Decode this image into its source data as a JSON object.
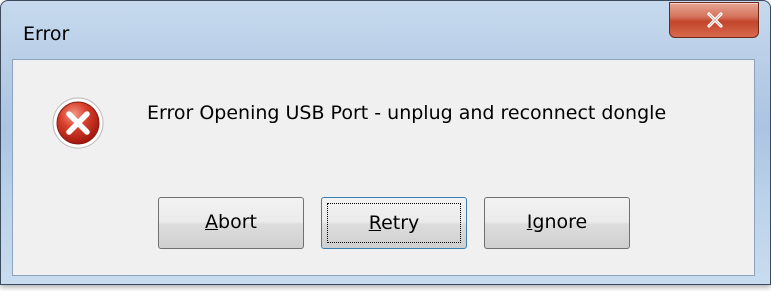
{
  "window": {
    "title": "Error",
    "close_icon": "close-x"
  },
  "dialog": {
    "icon": "error-icon",
    "message": "Error Opening USB Port - unplug and reconnect dongle"
  },
  "buttons": {
    "abort": {
      "label": "Abort",
      "mnemonic": "A",
      "rest": "bort"
    },
    "retry": {
      "label": "Retry",
      "mnemonic": "R",
      "rest": "etry",
      "focused": true
    },
    "ignore": {
      "label": "Ignore",
      "mnemonic": "I",
      "rest": "gnore"
    }
  },
  "colors": {
    "close_button": "#c2452b",
    "error_icon": "#c8281a",
    "client_bg": "#f0f0f0"
  }
}
